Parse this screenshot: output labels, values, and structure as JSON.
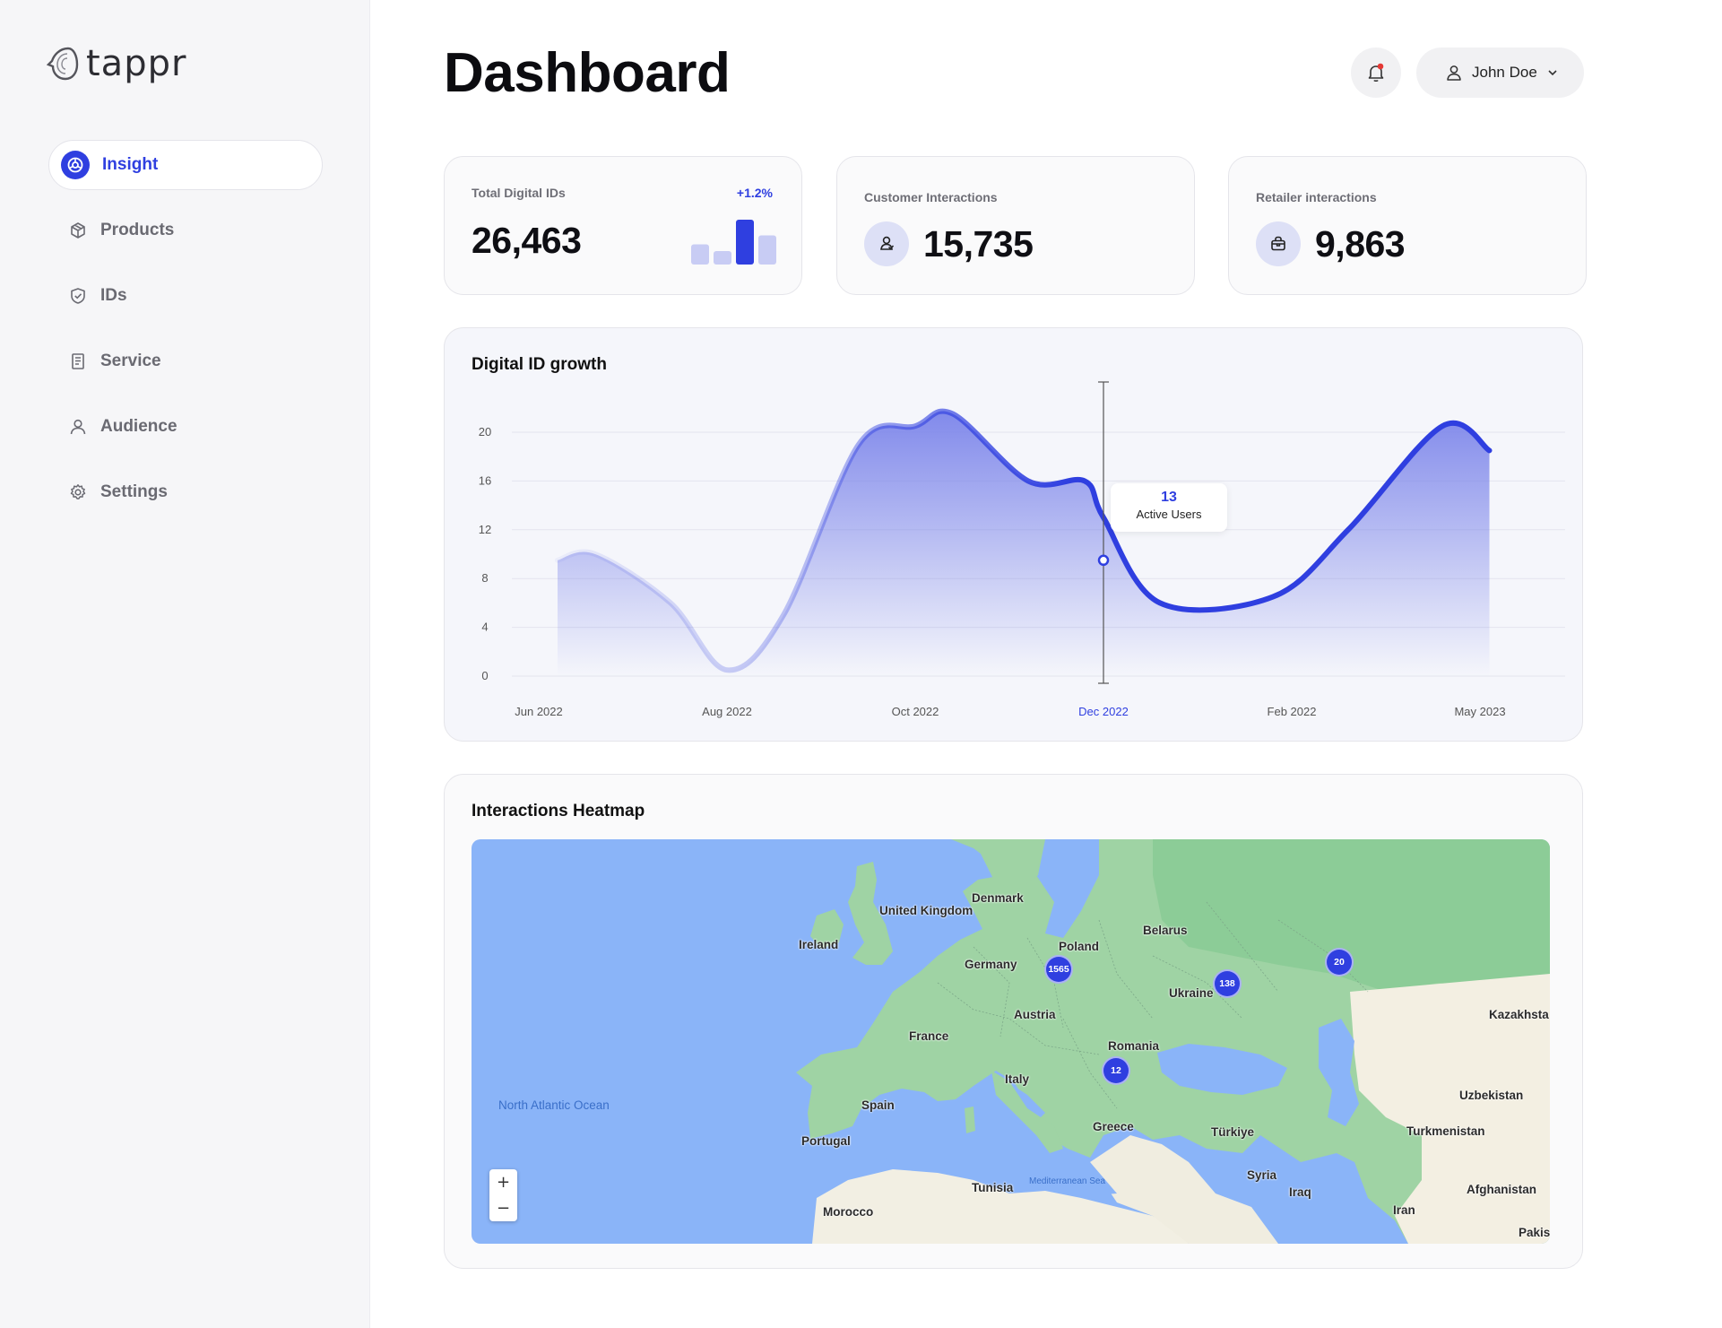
{
  "brand": {
    "name": "tappr"
  },
  "sidebar": {
    "items": [
      {
        "label": "Insight",
        "icon": "insight-icon",
        "active": true
      },
      {
        "label": "Products",
        "icon": "box-icon"
      },
      {
        "label": "IDs",
        "icon": "shield-check-icon"
      },
      {
        "label": "Service",
        "icon": "receipt-icon"
      },
      {
        "label": "Audience",
        "icon": "user-icon"
      },
      {
        "label": "Settings",
        "icon": "gear-icon"
      }
    ]
  },
  "header": {
    "title": "Dashboard",
    "user_name": "John Doe",
    "has_notification": true
  },
  "stats": {
    "total_ids": {
      "label": "Total Digital IDs",
      "value": "26,463",
      "change": "+1.2%",
      "mini_bars": [
        0.45,
        0.3,
        1.0,
        0.65
      ],
      "mini_highlight": 2
    },
    "customer": {
      "label": "Customer Interactions",
      "value": "15,735"
    },
    "retailer": {
      "label": "Retailer interactions",
      "value": "9,863"
    }
  },
  "chart_data": {
    "type": "area",
    "title": "Digital ID growth",
    "x": [
      "Jun 2022",
      "Aug 2022",
      "Oct 2022",
      "Dec 2022",
      "Feb 2022",
      "May 2023"
    ],
    "highlight_index": 3,
    "series": [
      {
        "values": [
          [
            0.1,
            9.5
          ],
          [
            0.3,
            10
          ],
          [
            0.7,
            6
          ],
          [
            1.0,
            0.5
          ],
          [
            1.3,
            5
          ],
          [
            1.7,
            19
          ],
          [
            2.0,
            20.5
          ],
          [
            2.2,
            21.5
          ],
          [
            2.6,
            16
          ],
          [
            2.9,
            16
          ],
          [
            3.0,
            13
          ],
          [
            3.3,
            6
          ],
          [
            3.9,
            6.5
          ],
          [
            4.3,
            12
          ],
          [
            4.8,
            20.5
          ],
          [
            5.05,
            18.5
          ]
        ]
      }
    ],
    "ylim": [
      0,
      20
    ],
    "yticks": [
      0,
      4,
      8,
      12,
      16,
      20
    ],
    "tooltip": {
      "x": 3.0,
      "value": "13",
      "label": "Active Users"
    },
    "grid": true,
    "colors": {
      "line": "#2f3fe0",
      "fill": "#7b84ea"
    }
  },
  "heatmap": {
    "title": "Interactions Heatmap",
    "countries": [
      "United Kingdom",
      "Ireland",
      "Denmark",
      "Belarus",
      "Poland",
      "Germany",
      "Ukraine",
      "Kazakhsta",
      "Austria",
      "France",
      "Romania",
      "Italy",
      "Uzbekistan",
      "Spain",
      "Greece",
      "Türkiye",
      "Turkmenistan",
      "Portugal",
      "Syria",
      "Tunisia",
      "Afghanistan",
      "Iraq",
      "Iran",
      "Morocco",
      "Pakis"
    ],
    "water": [
      "North Atlantic Ocean",
      "Mediterranean Sea"
    ],
    "clusters": [
      "1565",
      "138",
      "20",
      "12"
    ],
    "zoom_in": "+",
    "zoom_out": "−"
  }
}
